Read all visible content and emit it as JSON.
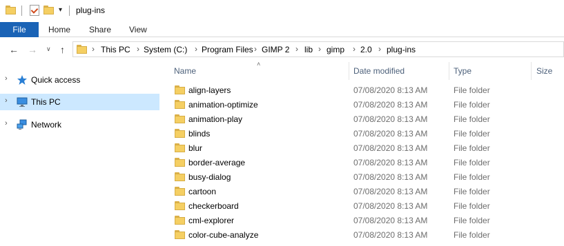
{
  "window": {
    "title": "plug-ins"
  },
  "ribbon": {
    "file": "File",
    "tabs": [
      "Home",
      "Share",
      "View"
    ]
  },
  "address": {
    "crumbs": [
      "This PC",
      "System (C:)",
      "Program Files",
      "GIMP 2",
      "lib",
      "gimp",
      "2.0",
      "plug-ins"
    ]
  },
  "navpane": {
    "items": [
      {
        "label": "Quick access",
        "icon": "star-icon"
      },
      {
        "label": "This PC",
        "icon": "computer-icon",
        "selected": true
      },
      {
        "label": "Network",
        "icon": "network-icon"
      }
    ]
  },
  "columns": {
    "name": "Name",
    "date": "Date modified",
    "type": "Type",
    "size": "Size"
  },
  "files": [
    {
      "name": "align-layers",
      "date": "07/08/2020 8:13 AM",
      "type": "File folder"
    },
    {
      "name": "animation-optimize",
      "date": "07/08/2020 8:13 AM",
      "type": "File folder"
    },
    {
      "name": "animation-play",
      "date": "07/08/2020 8:13 AM",
      "type": "File folder"
    },
    {
      "name": "blinds",
      "date": "07/08/2020 8:13 AM",
      "type": "File folder"
    },
    {
      "name": "blur",
      "date": "07/08/2020 8:13 AM",
      "type": "File folder"
    },
    {
      "name": "border-average",
      "date": "07/08/2020 8:13 AM",
      "type": "File folder"
    },
    {
      "name": "busy-dialog",
      "date": "07/08/2020 8:13 AM",
      "type": "File folder"
    },
    {
      "name": "cartoon",
      "date": "07/08/2020 8:13 AM",
      "type": "File folder"
    },
    {
      "name": "checkerboard",
      "date": "07/08/2020 8:13 AM",
      "type": "File folder"
    },
    {
      "name": "cml-explorer",
      "date": "07/08/2020 8:13 AM",
      "type": "File folder"
    },
    {
      "name": "color-cube-analyze",
      "date": "07/08/2020 8:13 AM",
      "type": "File folder"
    }
  ],
  "colors": {
    "accent": "#1a63b6",
    "selection": "#cce8ff",
    "folder": "#f5cf63"
  }
}
